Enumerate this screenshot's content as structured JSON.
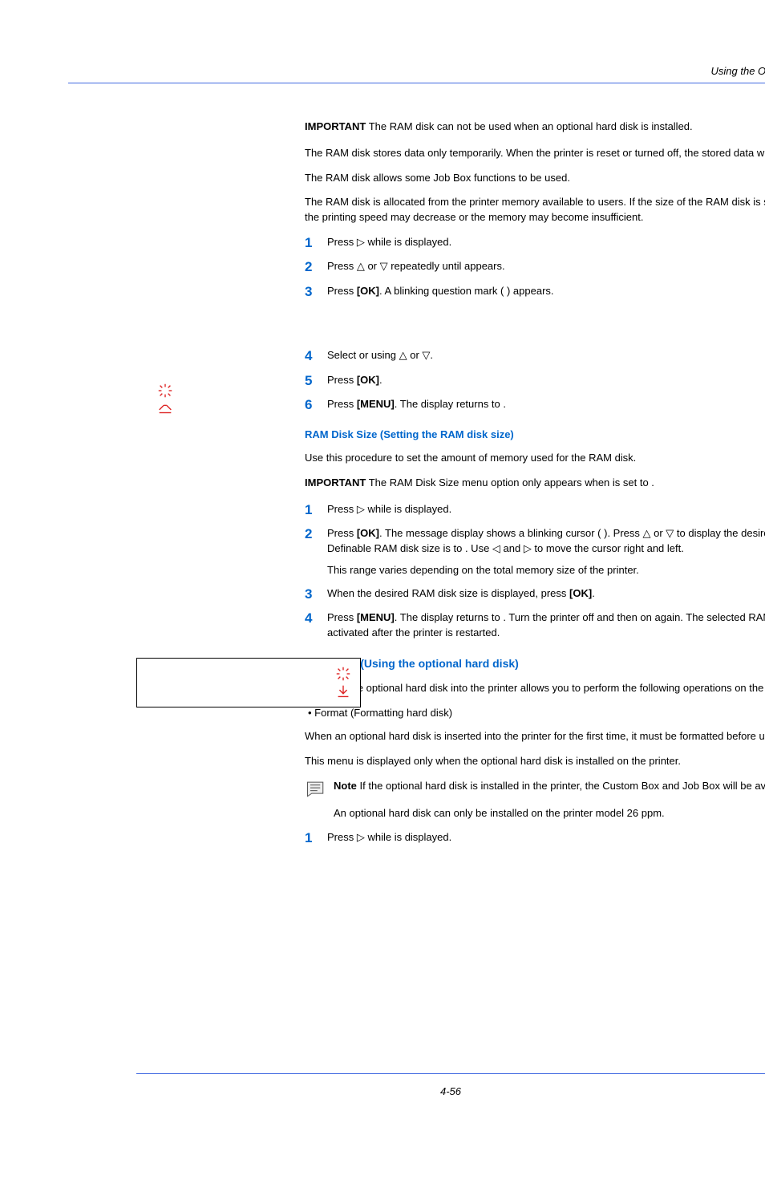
{
  "header": "Using the Operation Panel",
  "block1": {
    "important_label": "IMPORTANT",
    "important_text": "  The RAM disk can not be used when an optional hard disk is installed.",
    "p1": "The RAM disk stores data only temporarily. When the printer is reset or turned off, the stored data will be erased.",
    "p2": "The RAM disk allows some Job Box functions to be used.",
    "p3": "The RAM disk is allocated from the printer memory available to users. If the size of the RAM disk is set too large, the printing speed may decrease or the memory may become insufficient."
  },
  "steps1": {
    "s1": "Press ▷ while                                     is displayed.",
    "s2": "Press △ or ▽ repeatedly until                                            appears.",
    "s3_a": "Press ",
    "s3_b": "[OK]",
    "s3_c": ". A blinking question mark (  ) appears.",
    "s4": "Select       or          using △ or ▽.",
    "s5_a": "Press ",
    "s5_b": "[OK]",
    "s5_c": ".",
    "s6_a": "Press ",
    "s6_b": "[MENU]",
    "s6_c": ". The display returns to           ."
  },
  "section_ramdisk": {
    "heading": "RAM Disk Size (Setting the RAM disk size)",
    "intro": "Use this procedure to set the amount of memory used for the RAM disk.",
    "important_label": "IMPORTANT",
    "important_text": "  The RAM Disk Size menu option only appears when                            is set to       ."
  },
  "steps2": {
    "s1": "Press ▷ while                                                is displayed.",
    "s2_a": "Press ",
    "s2_b": "[OK]",
    "s2_c": ". The message display shows a blinking cursor (  ). Press △ or ▽ to display the desired size. Definable RAM disk size is           to           . Use ◁ and ▷ to move the cursor right and left.",
    "s2_p2": "This range varies depending on the total memory size of the printer.",
    "s3_a": " When the desired RAM disk size is displayed, press ",
    "s3_b": "[OK]",
    "s3_c": ".",
    "s4_a": "Press ",
    "s4_b": "[MENU]",
    "s4_c": ". The display returns to            . Turn the printer off and then on again. The selected RAM disk size is activated after the printer is restarted."
  },
  "section_hdd": {
    "heading": "Hard Disk (Using the optional hard disk)",
    "p1": "Installing the optional hard disk into the printer allows you to perform the following operations on the hard disk.",
    "bullet": "•   Format (Formatting hard disk)",
    "p2": "When an optional hard disk is inserted into the printer for the first time, it must be formatted before use.",
    "p3": "This menu is displayed only when the optional hard disk is installed on the printer.",
    "note_label": "Note",
    "note_text": "  If the optional hard disk is installed in the printer, the Custom Box and Job Box will be available.",
    "note_sub": "An optional hard disk can only be installed on the printer model 26 ppm."
  },
  "steps3": {
    "s1": "Press ▷ while                                     is displayed."
  },
  "footer": "4-56"
}
